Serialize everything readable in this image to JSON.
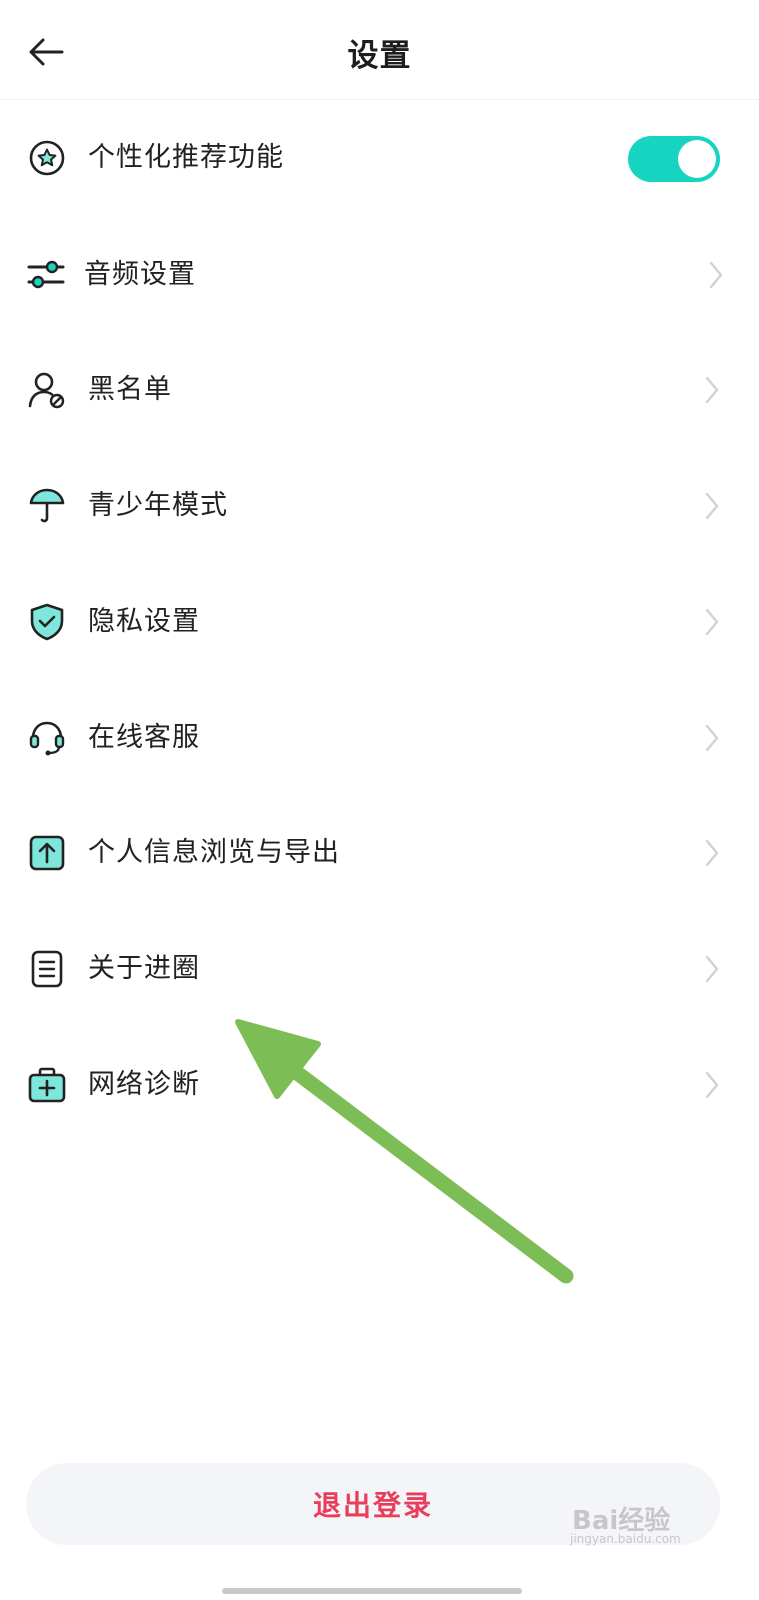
{
  "header": {
    "title": "设置",
    "back_icon": "arrow-left-icon"
  },
  "settings": {
    "personalized": {
      "label": "个性化推荐功能",
      "icon": "star-circle-icon",
      "toggle_on": true
    },
    "items": [
      {
        "label": "音频设置",
        "icon": "sliders-icon"
      },
      {
        "label": "黑名单",
        "icon": "user-blocked-icon"
      },
      {
        "label": "青少年模式",
        "icon": "umbrella-icon"
      },
      {
        "label": "隐私设置",
        "icon": "shield-check-icon"
      },
      {
        "label": "在线客服",
        "icon": "headset-icon"
      },
      {
        "label": "个人信息浏览与导出",
        "icon": "export-upload-icon"
      },
      {
        "label": "关于进圈",
        "icon": "document-icon"
      },
      {
        "label": "网络诊断",
        "icon": "medical-kit-icon"
      }
    ]
  },
  "logout": {
    "label": "退出登录"
  },
  "colors": {
    "accent": "#16d4c0",
    "logout_text": "#e83e5c",
    "annotation_arrow": "#7dbd55"
  },
  "watermark": {
    "text": "Bai经验",
    "sub": "jingyan.baidu.com"
  }
}
